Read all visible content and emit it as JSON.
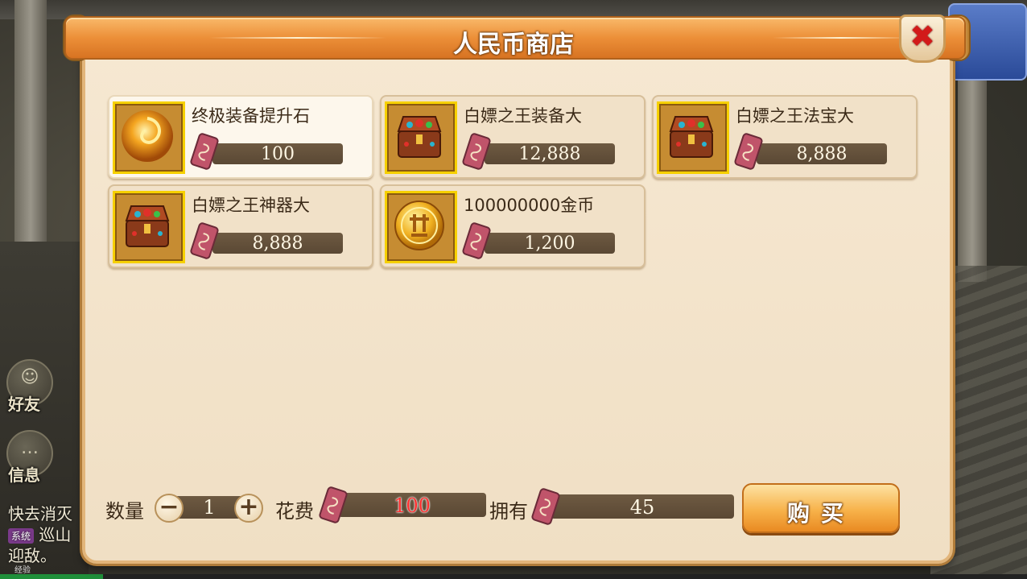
{
  "dialog": {
    "title": "人民币商店",
    "close_label": "✖"
  },
  "items": [
    {
      "name": "终极装备提升石",
      "price": "100",
      "icon": "golden-orb-icon",
      "selected": true
    },
    {
      "name": "白嫖之王装备大",
      "price": "12,888",
      "icon": "treasure-chest-icon",
      "selected": false
    },
    {
      "name": "白嫖之王法宝大",
      "price": "8,888",
      "icon": "treasure-chest-icon",
      "selected": false
    },
    {
      "name": "白嫖之王神器大",
      "price": "8,888",
      "icon": "treasure-chest-icon",
      "selected": false
    },
    {
      "name": "100000000金币",
      "price": "1,200",
      "icon": "gold-coin-icon",
      "selected": false
    }
  ],
  "purchase": {
    "quantity_label": "数量",
    "quantity_value": "1",
    "decrement": "−",
    "increment": "+",
    "cost_label": "花费",
    "cost_value": "100",
    "owned_label": "拥有",
    "owned_value": "45",
    "buy_label": "购买"
  },
  "background": {
    "friends_label": "好友",
    "messages_label": "信息",
    "chat_line_1": "快去消灭",
    "chat_tag": "系统",
    "chat_line_2": "巡山",
    "chat_line_3": "迎敌。",
    "xp_label": "经验",
    "xp_progress": 0.1
  },
  "colors": {
    "title_bar": "#ec8f38",
    "panel": "#f3e3c9",
    "price_bar": "#5a4834",
    "cost_highlight": "#ff3030",
    "close_x": "#d21a1a"
  }
}
